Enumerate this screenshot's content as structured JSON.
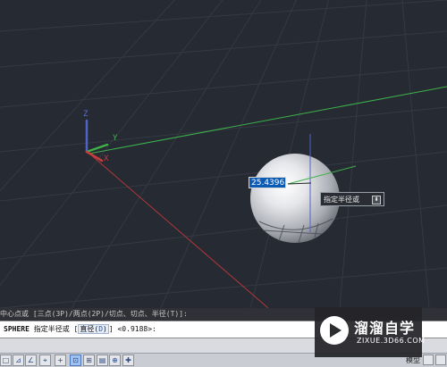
{
  "viewport": {
    "ucs_labels": {
      "z": "Z",
      "y": "Y",
      "x": "X"
    },
    "dynamic_input": {
      "value": "25.4396"
    },
    "tooltip": {
      "label": "指定半径或",
      "button_glyph": "⬇"
    }
  },
  "command": {
    "history": "中心点或 [三点(3P)/两点(2P)/切点、切点、半径(T)]:",
    "name": "SPHERE",
    "prompt": "指定半径或 [",
    "option_label": "直径(",
    "option_key": "D",
    "option_close": ")",
    "suffix": "] <0.9188>:"
  },
  "statusbar": {
    "buttons": [
      {
        "icon": "ortho-icon",
        "glyph": "□",
        "active": false
      },
      {
        "icon": "polar-icon",
        "glyph": "⊿",
        "active": false
      },
      {
        "icon": "osnap-icon",
        "glyph": "∠",
        "active": false
      },
      {
        "icon": "3dosnap-icon",
        "glyph": "⌖",
        "active": false
      },
      {
        "icon": "otrack-icon",
        "glyph": "+",
        "active": false
      },
      {
        "icon": "ducs-icon",
        "glyph": "⊡",
        "active": true
      },
      {
        "icon": "dyn-icon",
        "glyph": "⊞",
        "active": false
      },
      {
        "icon": "lwt-icon",
        "glyph": "▤",
        "active": false
      },
      {
        "icon": "tpy-icon",
        "glyph": "⊕",
        "active": false
      },
      {
        "icon": "qp-icon",
        "glyph": "✚",
        "active": false
      }
    ],
    "model_label": "模型"
  },
  "watermark": {
    "title": "溜溜自学",
    "url": "ZIXUE.3D66.COM"
  },
  "colors": {
    "background": "#262a33",
    "grid": "#32363f",
    "x_axis": "#b03838",
    "y_axis": "#3fb14a",
    "z_axis": "#4f63c8",
    "accent": "#0b5ab4"
  }
}
